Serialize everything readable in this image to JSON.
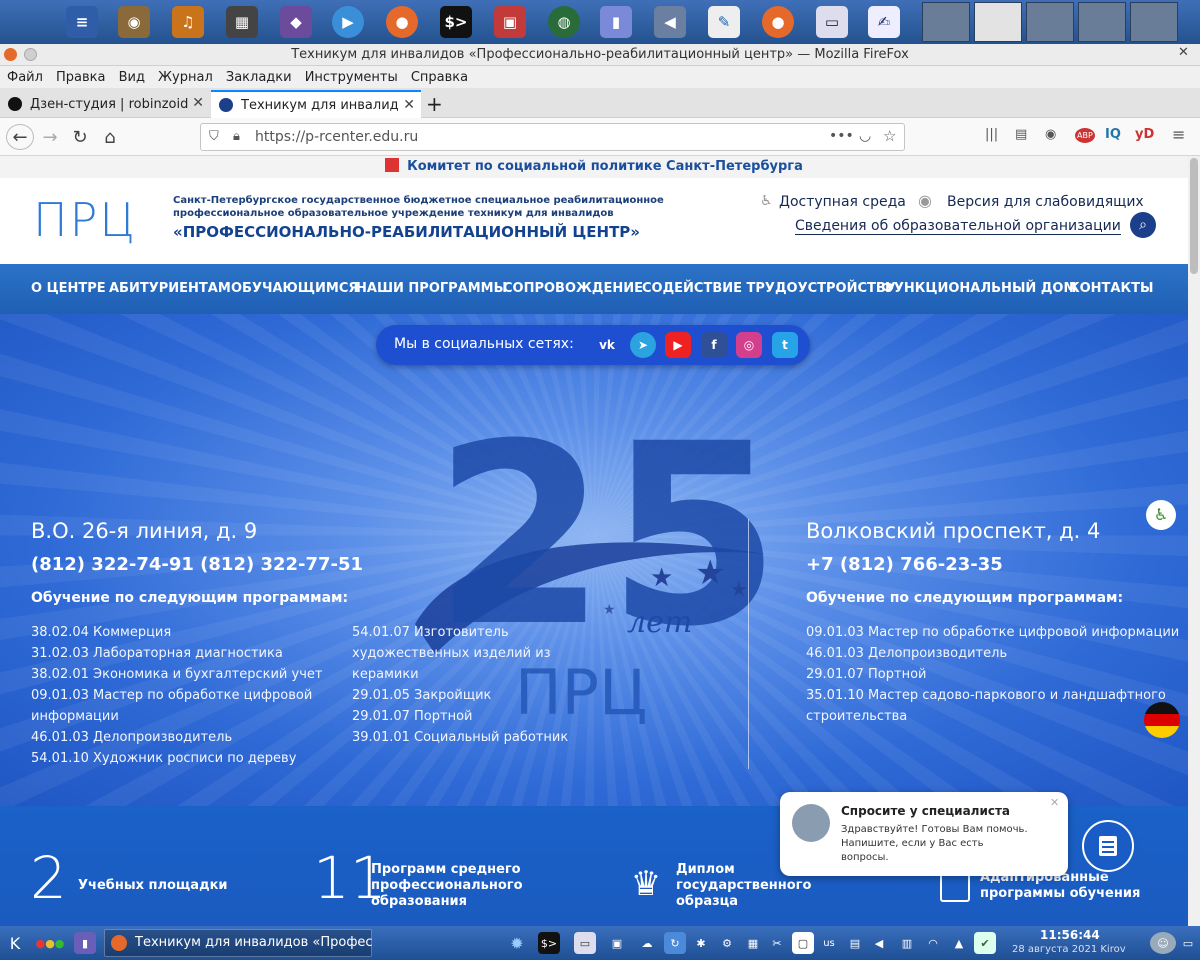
{
  "window": {
    "title": "Техникум для инвалидов «Профессионально-реабилитационный центр» — Mozilla FireFox"
  },
  "menu": [
    "Файл",
    "Правка",
    "Вид",
    "Журнал",
    "Закладки",
    "Инструменты",
    "Справка"
  ],
  "tabs": [
    {
      "label": "Дзен-студия | robinzoid",
      "active": false
    },
    {
      "label": "Техникум для инвалид",
      "active": true
    }
  ],
  "url": "https://p-rcenter.edu.ru",
  "site": {
    "committee": "Комитет по социальной политике Санкт-Петербурга",
    "logo": "ПРЦ",
    "org_small_1": "Санкт-Петербургское государственное бюджетное специальное реабилитационное",
    "org_small_2": "профессиональное образовательное учреждение техникум для инвалидов",
    "org_big": "«ПРОФЕССИОНАЛЬНО-РЕАБИЛИТАЦИОННЫЙ ЦЕНТР»",
    "accessible": "Доступная среда",
    "low_vision": "Версия для слабовидящих",
    "edu_info": "Сведения об образовательной организации",
    "nav": [
      "О ЦЕНТРЕ",
      "АБИТУРИЕНТАМ",
      "ОБУЧАЮЩИМСЯ",
      "НАШИ ПРОГРАММЫ",
      "СОПРОВОЖДЕНИЕ",
      "СОДЕЙСТВИЕ ТРУДОУСТРОЙСТВУ",
      "ФУНКЦИОНАЛЬНЫЙ ДОМ",
      "КОНТАКТЫ"
    ],
    "social_label": "Мы в социальных сетях:",
    "anniv_num": "25",
    "anniv_word": "лет",
    "anniv_logo": "ПРЦ",
    "left": {
      "address": "В.О. 26-я линия, д. 9",
      "phones": "(812) 322-74-91 (812) 322-77-51",
      "prog_heading": "Обучение по следующим программам:",
      "col1": [
        "38.02.04 Коммерция",
        "31.02.03 Лабораторная диагностика",
        "38.02.01 Экономика и бухгалтерский учет",
        "09.01.03 Мастер по обработке цифровой",
        "информации",
        "46.01.03 Делопроизводитель",
        "54.01.10 Художник росписи по дереву"
      ],
      "col2": [
        "54.01.07 Изготовитель",
        "художественных изделий из",
        "керамики",
        "29.01.05 Закройщик",
        "29.01.07 Портной",
        "39.01.01 Социальный работник"
      ]
    },
    "right": {
      "address": "Волковский проспект, д. 4",
      "phones": "+7 (812) 766-23-35",
      "prog_heading": "Обучение по следующим программам:",
      "col": [
        "09.01.03 Мастер по обработке цифровой информации",
        "46.01.03 Делопроизводитель",
        "29.01.07 Портной",
        "35.01.10 Мастер садово-паркового и ландшафтного",
        "строительства"
      ]
    },
    "stats": [
      {
        "num": "2",
        "text": [
          "Учебных площадки"
        ]
      },
      {
        "num": "11",
        "text": [
          "Программ среднего",
          "профессионального",
          "образования"
        ]
      },
      {
        "num": "",
        "text": [
          "Диплом",
          "государственного",
          "образца"
        ]
      },
      {
        "num": "",
        "text": [
          "Адаптированные",
          "программы обучения"
        ]
      }
    ],
    "chat": {
      "title": "Спросите у специалиста",
      "lines": [
        "Здравствуйте! Готовы Вам помочь.",
        "Напишите, если у Вас есть",
        "вопросы."
      ]
    }
  },
  "taskbar": {
    "task": "Техникум для инвалидов «Профес",
    "lang": "us",
    "time": "11:56:44",
    "date": "28 августа 2021 Kirov"
  },
  "colors": {
    "brand": "#1f5fb4",
    "nav_text": "#ffffff",
    "title_blue": "#13428f"
  }
}
